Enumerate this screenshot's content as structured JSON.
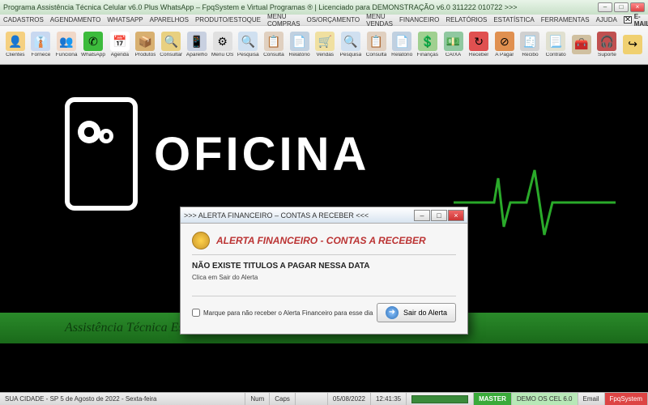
{
  "window": {
    "title": "Programa Assistência Técnica Celular v6.0 Plus WhatsApp – FpqSystem e Virtual Programas ® | Licenciado para  DEMONSTRAÇÃO v6.0 311222 010722 >>>"
  },
  "menu": {
    "items": [
      "CADASTROS",
      "AGENDAMENTO",
      "WHATSAPP",
      "APARELHOS",
      "PRODUTO/ESTOQUE",
      "MENU COMPRAS",
      "OS/ORÇAMENTO",
      "MENU VENDAS",
      "FINANCEIRO",
      "RELATÓRIOS",
      "ESTATÍSTICA",
      "FERRAMENTAS",
      "AJUDA"
    ],
    "email": "E-MAIL"
  },
  "toolbar": {
    "items": [
      {
        "label": "Clientes",
        "icon": "👤",
        "bg": "#f5d080"
      },
      {
        "label": "Fornece",
        "icon": "👔",
        "bg": "#c8d8f0"
      },
      {
        "label": "Funciona",
        "icon": "👥",
        "bg": "#f0d8c8"
      },
      {
        "label": "WhatsApp",
        "icon": "✆",
        "bg": "#3cbb3c"
      },
      {
        "label": "Agenda",
        "icon": "📅",
        "bg": "#fff"
      },
      {
        "label": "Produtos",
        "icon": "📦",
        "bg": "#d8b070"
      },
      {
        "label": "Consultar",
        "icon": "🔍",
        "bg": "#e8d080"
      },
      {
        "label": "Aparelho",
        "icon": "📱",
        "bg": "#c8d0e0"
      },
      {
        "label": "Menu OS",
        "icon": "⚙",
        "bg": "#e0e0e0"
      },
      {
        "label": "Pesquisa",
        "icon": "🔍",
        "bg": "#d0e0f0"
      },
      {
        "label": "Consulta",
        "icon": "📋",
        "bg": "#e0d0c0"
      },
      {
        "label": "Relatório",
        "icon": "📄",
        "bg": "#c0d0e0"
      },
      {
        "label": "Vendas",
        "icon": "🛒",
        "bg": "#f0e0a0"
      },
      {
        "label": "Pesquisa",
        "icon": "🔍",
        "bg": "#d0e0f0"
      },
      {
        "label": "Consulta",
        "icon": "📋",
        "bg": "#e0d0c0"
      },
      {
        "label": "Relatório",
        "icon": "📄",
        "bg": "#c0d0e0"
      },
      {
        "label": "Finanças",
        "icon": "💲",
        "bg": "#a0d090"
      },
      {
        "label": "CAIXA",
        "icon": "💵",
        "bg": "#90c8a0"
      },
      {
        "label": "Receber",
        "icon": "↻",
        "bg": "#e05050"
      },
      {
        "label": "A Pagar",
        "icon": "⊘",
        "bg": "#e09050"
      },
      {
        "label": "Recibo",
        "icon": "🧾",
        "bg": "#d0d0d0"
      },
      {
        "label": "Contrato",
        "icon": "📃",
        "bg": "#e0e0d0"
      },
      {
        "label": "",
        "icon": "🧰",
        "bg": "#d0c0a0"
      },
      {
        "label": "Suporte",
        "icon": "🎧",
        "bg": "#c05050"
      },
      {
        "label": "",
        "icon": "↪",
        "bg": "#f0d070"
      }
    ]
  },
  "brand": {
    "title": "OFICINA",
    "subtitle": "Assistência Técnica Especializada em Geral"
  },
  "dialog": {
    "title": ">>> ALERTA FINANCEIRO – CONTAS A RECEBER <<<",
    "header": "ALERTA FINANCEIRO - CONTAS A RECEBER",
    "msg1": "NÃO EXISTE TITULOS A PAGAR NESSA DATA",
    "msg2": "Clica em Sair do Alerta",
    "checkbox": "Marque para não receber o Alerta Financeiro para esse dia",
    "button": "Sair do Alerta"
  },
  "status": {
    "location": "SUA CIDADE - SP  5 de Agosto de 2022 - Sexta-feira",
    "num": "Num",
    "caps": "Caps",
    "date": "05/08/2022",
    "time": "12:41:35",
    "master": "MASTER",
    "demo": "DEMO OS CEL 6.0",
    "email": "Email",
    "brand": "FpqSystem"
  }
}
